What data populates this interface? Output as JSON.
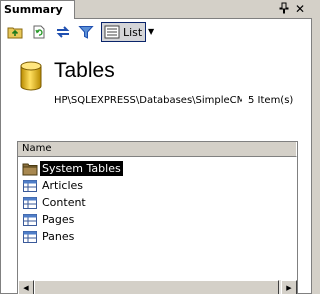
{
  "window": {
    "tab_label": "Summary"
  },
  "toolbar": {
    "list_label": "List",
    "buttons": [
      "up-folder-icon",
      "refresh-icon",
      "sync-icon",
      "filter-icon"
    ]
  },
  "header": {
    "title": "Tables",
    "path": "HP\\SQLEXPRESS\\Databases\\SimpleCMS",
    "item_count": "5 Item(s)"
  },
  "list": {
    "column_name": "Name",
    "items": [
      {
        "label": "System Tables",
        "icon": "folder-icon",
        "selected": true
      },
      {
        "label": "Articles",
        "icon": "table-icon",
        "selected": false
      },
      {
        "label": "Content",
        "icon": "table-icon",
        "selected": false
      },
      {
        "label": "Pages",
        "icon": "table-icon",
        "selected": false
      },
      {
        "label": "Panes",
        "icon": "table-icon",
        "selected": false
      }
    ]
  },
  "colors": {
    "accent": "#0a246a",
    "background": "#d4d0c8",
    "selection": "#000000"
  }
}
